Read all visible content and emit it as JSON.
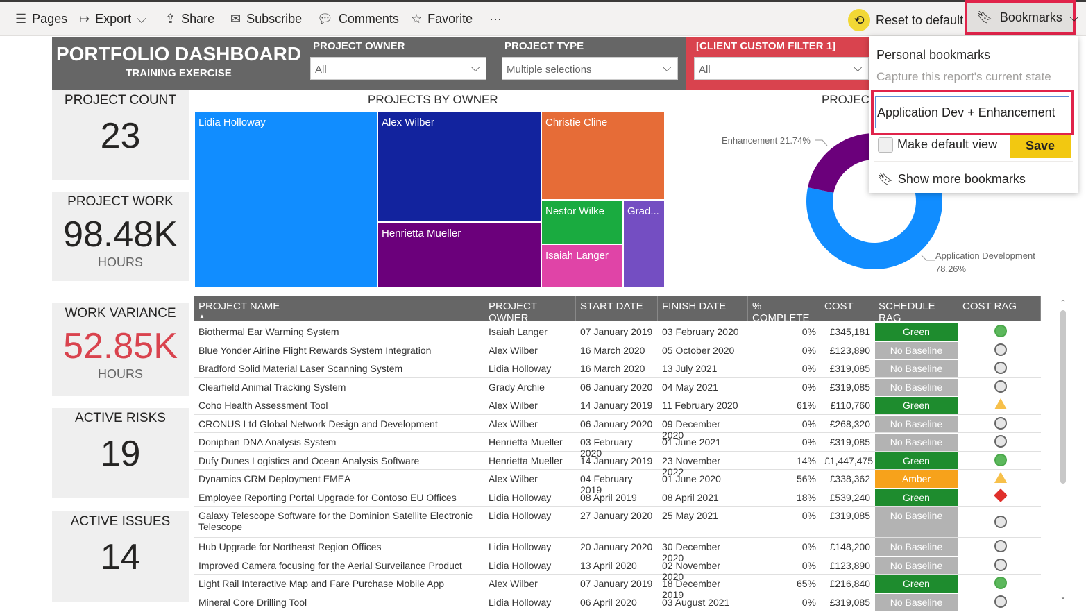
{
  "toolbar": {
    "pages": "Pages",
    "export": "Export",
    "share": "Share",
    "subscribe": "Subscribe",
    "comments": "Comments",
    "favorite": "Favorite",
    "more": "···",
    "reset": "Reset to default",
    "bookmarks": "Bookmarks"
  },
  "header": {
    "title": "PORTFOLIO DASHBOARD",
    "subtitle": "TRAINING EXERCISE",
    "filters": [
      {
        "label": "PROJECT OWNER",
        "value": "All"
      },
      {
        "label": "PROJECT TYPE",
        "value": "Multiple selections"
      },
      {
        "label": "[CLIENT CUSTOM FILTER 1]",
        "value": "All"
      }
    ]
  },
  "cards": [
    {
      "title": "PROJECT COUNT",
      "value": "23",
      "unit": ""
    },
    {
      "title": "PROJECT WORK",
      "value": "98.48K",
      "unit": "HOURS"
    },
    {
      "title": "WORK VARIANCE",
      "value": "52.85K",
      "unit": "HOURS"
    },
    {
      "title": "ACTIVE RISKS",
      "value": "19",
      "unit": ""
    },
    {
      "title": "ACTIVE ISSUES",
      "value": "14",
      "unit": ""
    }
  ],
  "treemap": {
    "title": "PROJECTS BY OWNER",
    "cells": [
      "Lidia Holloway",
      "Alex Wilber",
      "Henrietta Mueller",
      "Christie Cline",
      "Nestor Wilke",
      "Isaiah Langer",
      "Grad..."
    ]
  },
  "chart_data": {
    "type": "pie",
    "title": "PROJECT",
    "donut": true,
    "slices": [
      {
        "label": "Application Development",
        "value": 78.26,
        "display": "78.26%",
        "color": "#118dff"
      },
      {
        "label": "Enhancement",
        "value": 21.74,
        "display": "21.74%",
        "color": "#6b007b"
      }
    ]
  },
  "table": {
    "columns": [
      "PROJECT NAME",
      "PROJECT OWNER",
      "START DATE",
      "FINISH DATE",
      "% COMPLETE",
      "COST",
      "SCHEDULE RAG",
      "COST RAG"
    ],
    "rows": [
      [
        "Biothermal Ear Warming System",
        "Isaiah Langer",
        "07 January 2019",
        "03 February 2020",
        "0%",
        "£345,181",
        "Green",
        "green"
      ],
      [
        "Blue Yonder Airline Flight Rewards System Integration",
        "Alex Wilber",
        "16 March 2020",
        "05 October 2020",
        "0%",
        "£123,890",
        "No Baseline",
        "grey"
      ],
      [
        "Bradford Solid Material Laser Scanning System",
        "Lidia Holloway",
        "16 March 2020",
        "13 July 2021",
        "0%",
        "£319,085",
        "No Baseline",
        "grey"
      ],
      [
        "Clearfield Animal Tracking System",
        "Grady Archie",
        "06 January 2020",
        "04 May 2021",
        "0%",
        "£319,085",
        "No Baseline",
        "grey"
      ],
      [
        "Coho Health Assessment Tool",
        "Alex Wilber",
        "14 January 2019",
        "11 February 2020",
        "61%",
        "£110,760",
        "Green",
        "amber"
      ],
      [
        "CRONUS Ltd Global Network Design and Development",
        "Alex Wilber",
        "06 January 2020",
        "09 December 2020",
        "0%",
        "£268,320",
        "No Baseline",
        "grey"
      ],
      [
        "Doniphan DNA Analysis System",
        "Henrietta Mueller",
        "03 February 2020",
        "01 June 2021",
        "0%",
        "£319,085",
        "No Baseline",
        "grey"
      ],
      [
        "Dufy Dunes Logistics and Ocean Analysis Software",
        "Henrietta Mueller",
        "14 January 2019",
        "23 November 2022",
        "14%",
        "£1,447,475",
        "Green",
        "green"
      ],
      [
        "Dynamics CRM Deployment EMEA",
        "Alex Wilber",
        "04 February 2019",
        "01 June 2020",
        "56%",
        "£338,362",
        "Amber",
        "amber"
      ],
      [
        "Employee Reporting Portal Upgrade for Contoso EU Offices",
        "Lidia Holloway",
        "08 April 2019",
        "08 April 2021",
        "18%",
        "£539,240",
        "Green",
        "red"
      ],
      [
        "Galaxy Telescope Software for the Dominion Satellite Electronic Telescope",
        "Lidia Holloway",
        "27 January 2020",
        "25 May 2021",
        "0%",
        "£319,085",
        "No Baseline",
        "grey"
      ],
      [
        "Hub Upgrade for Northeast Region Offices",
        "Lidia Holloway",
        "20 January 2020",
        "30 December 2020",
        "0%",
        "£148,200",
        "No Baseline",
        "grey"
      ],
      [
        "Improved Camera focusing for the Aerial Surveilance Product",
        "Lidia Holloway",
        "13 April 2020",
        "02 November 2020",
        "0%",
        "£123,890",
        "No Baseline",
        "grey"
      ],
      [
        "Light Rail Interactive Map and Fare Purchase Mobile App",
        "Alex Wilber",
        "07 January 2019",
        "18 December 2019",
        "65%",
        "£216,840",
        "Green",
        "green"
      ],
      [
        "Mineral Core Drilling Tool",
        "Lidia Holloway",
        "06 April 2020",
        "03 August 2021",
        "0%",
        "£319,085",
        "No Baseline",
        "grey"
      ]
    ]
  },
  "rag_colors": {
    "Green": "#1e8c2e",
    "No Baseline": "#b3b3b3",
    "Amber": "#f7a21b",
    "green": "#5cb85c",
    "grey": "#777",
    "amber": "#f7c04a",
    "red": "#e0302b"
  },
  "bookmarks_popup": {
    "heading": "Personal bookmarks",
    "placeholder": "Capture this report's current state",
    "input_value": "Application Dev + Enhancement",
    "default_label": "Make default view",
    "save": "Save",
    "show_more": "Show more bookmarks"
  }
}
